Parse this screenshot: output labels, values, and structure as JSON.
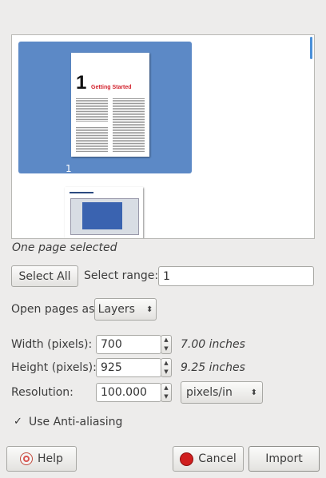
{
  "preview": {
    "thumbnails": [
      {
        "label": "1",
        "selected": true,
        "chapter_number": "1",
        "chapter_title": "Getting Started"
      },
      {
        "label": "",
        "selected": false
      }
    ]
  },
  "status_text": "One page selected",
  "select_all_label": "Select All",
  "select_range_label": "Select range:",
  "select_range_value": "1",
  "open_pages_as_label": "Open pages as",
  "open_pages_as_value": "Layers",
  "width": {
    "label": "Width (pixels):",
    "value": "700",
    "unit": "7.00 inches"
  },
  "height": {
    "label": "Height (pixels):",
    "value": "925",
    "unit": "9.25 inches"
  },
  "resolution": {
    "label": "Resolution:",
    "value": "100.000",
    "unit": "pixels/in"
  },
  "antialias": {
    "label": "Use Anti-aliasing",
    "checked": true
  },
  "buttons": {
    "help": "Help",
    "cancel": "Cancel",
    "import": "Import"
  },
  "icons": {
    "help": "help-lifebuoy-icon",
    "cancel": "stop-icon",
    "spin_up": "chevron-up-icon",
    "spin_down": "chevron-down-icon",
    "combo": "up-down-arrows-icon",
    "check": "checkmark-icon"
  },
  "colors": {
    "selection": "#5c89c6",
    "title_red": "#d21f2a",
    "background": "#edeceb"
  }
}
